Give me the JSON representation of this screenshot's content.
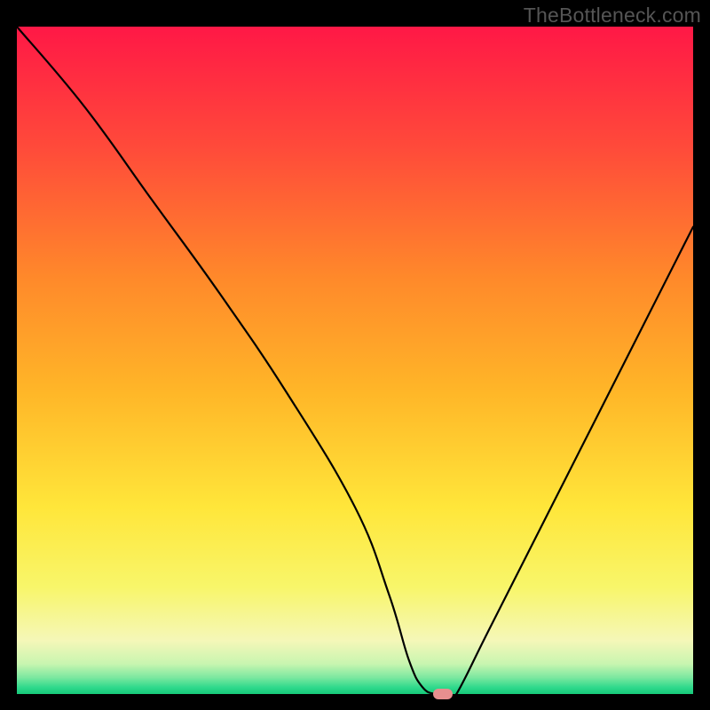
{
  "watermark": "TheBottleneck.com",
  "chart_data": {
    "type": "line",
    "title": "",
    "xlabel": "",
    "ylabel": "",
    "xlim": [
      0,
      100
    ],
    "ylim": [
      0,
      100
    ],
    "series": [
      {
        "name": "bottleneck-curve",
        "x": [
          0,
          10,
          20,
          30,
          40,
          50,
          55,
          58,
          60,
          62,
          64,
          65,
          70,
          80,
          90,
          100
        ],
        "y": [
          100,
          88,
          74,
          60,
          45,
          28,
          15,
          5,
          1,
          0,
          0,
          0,
          10,
          30,
          50,
          70
        ]
      }
    ],
    "marker": {
      "x": 63,
      "y": 0
    },
    "gradient_stops": [
      {
        "offset": 0.0,
        "color": "#ff1846"
      },
      {
        "offset": 0.18,
        "color": "#ff4a3a"
      },
      {
        "offset": 0.38,
        "color": "#ff8a2a"
      },
      {
        "offset": 0.55,
        "color": "#ffb728"
      },
      {
        "offset": 0.72,
        "color": "#ffe63a"
      },
      {
        "offset": 0.84,
        "color": "#f8f66a"
      },
      {
        "offset": 0.92,
        "color": "#f5f7b8"
      },
      {
        "offset": 0.955,
        "color": "#c8f5b0"
      },
      {
        "offset": 0.975,
        "color": "#7de8a0"
      },
      {
        "offset": 0.99,
        "color": "#2fd98c"
      },
      {
        "offset": 1.0,
        "color": "#16c979"
      }
    ]
  }
}
